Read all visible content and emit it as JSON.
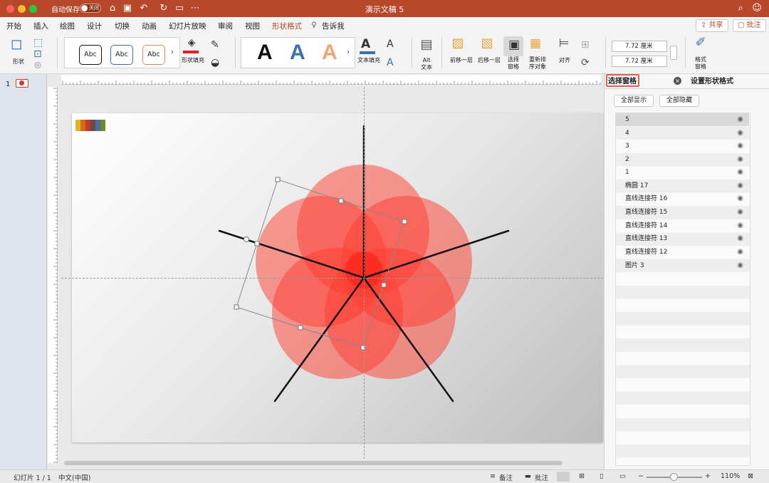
{
  "titlebar": {
    "autosave_label": "自动保存",
    "autosave_state": "关闭",
    "document_title": "演示文稿 5",
    "accent_color": "#b7472a"
  },
  "tabs": [
    "开始",
    "插入",
    "绘图",
    "设计",
    "切换",
    "动画",
    "幻灯片放映",
    "审阅",
    "视图",
    "形状格式"
  ],
  "tell_me": "告诉我",
  "header_buttons": {
    "share": "共享",
    "comments": "批注"
  },
  "ribbon": {
    "shapes_label": "形状",
    "style_previews": [
      "Abc",
      "Abc",
      "Abc"
    ],
    "shape_fill_label": "形状填充",
    "wordart_previews": [
      "A",
      "A",
      "A"
    ],
    "text_fill_label": "文本填充",
    "alt_text_label": "Alt\n文本",
    "bring_forward": "前移一层",
    "send_backward": "后移一层",
    "selection_pane": "选择\n窗格",
    "reorder_objects": "重新排\n序对象",
    "align": "对齐",
    "height_value": "7.72 厘米",
    "width_value": "7.72 厘米",
    "format_pane": "格式\n窗格"
  },
  "thumbnails": {
    "slide_number": "1"
  },
  "pane": {
    "tab_selection": "选择窗格",
    "tab_format": "设置形状格式",
    "show_all": "全部显示",
    "hide_all": "全部隐藏",
    "items": [
      "5",
      "4",
      "3",
      "2",
      "1",
      "椭圆 17",
      "直线连接符 16",
      "直线连接符 15",
      "直线连接符 14",
      "直线连接符 13",
      "直线连接符 12",
      "图片 3"
    ],
    "selected_item": "5",
    "eye_icon": "eye-icon"
  },
  "slide": {
    "petal_color": "#ff3b30",
    "line_color": "#111111"
  },
  "statusbar": {
    "slide_info": "幻灯片 1 / 1",
    "language": "中文(中国)",
    "notes": "备注",
    "comments": "批注",
    "zoom": "110%"
  }
}
